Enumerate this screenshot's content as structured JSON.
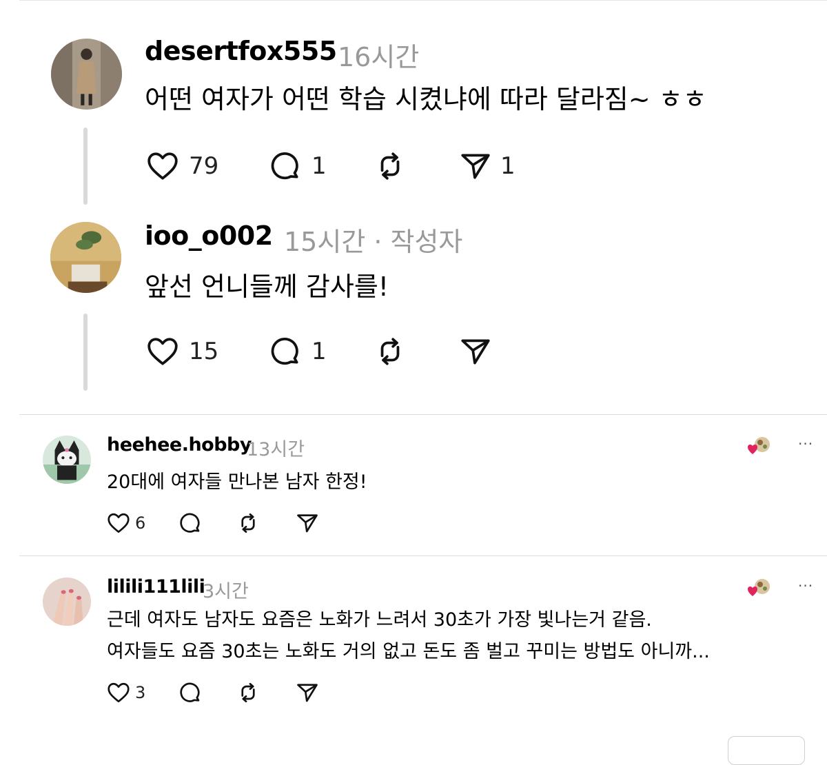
{
  "comments_large": [
    {
      "username": "desertfox555",
      "time": "16시간",
      "text": "어떤 여자가 어떤 학습 시켰냐에 따라 달라짐~ ㅎㅎ",
      "likes": "79",
      "replies": "1",
      "shares": "1"
    },
    {
      "username": "ioo_o002",
      "time": "15시간 · 작성자",
      "text": "앞선 언니들께 감사를!",
      "likes": "15",
      "replies": "1"
    }
  ],
  "comments_small": [
    {
      "username": "heehee.hobby",
      "time": "13시간",
      "text": "20대에 여자들 만나본 남자 한정!",
      "likes": "6",
      "more": "···"
    },
    {
      "username": "lilili111lili",
      "time": "3시간",
      "text_line1": "근데 여자도 남자도 요즘은 노화가 느려서 30초가 가장 빛나는거 같음.",
      "text_line2": "여자들도 요즘 30초는 노화도 거의 없고 돈도 좀 벌고 꾸미는 방법도 아니까...",
      "likes": "3",
      "more": "···"
    }
  ],
  "icons": [
    "heart-icon",
    "comment-icon",
    "repost-icon",
    "share-icon",
    "more-icon",
    "reaction-icon"
  ],
  "colors": {
    "meta_gray": "#999999",
    "like_red": "#e0245e",
    "thread_line": "#d9d9d9"
  }
}
